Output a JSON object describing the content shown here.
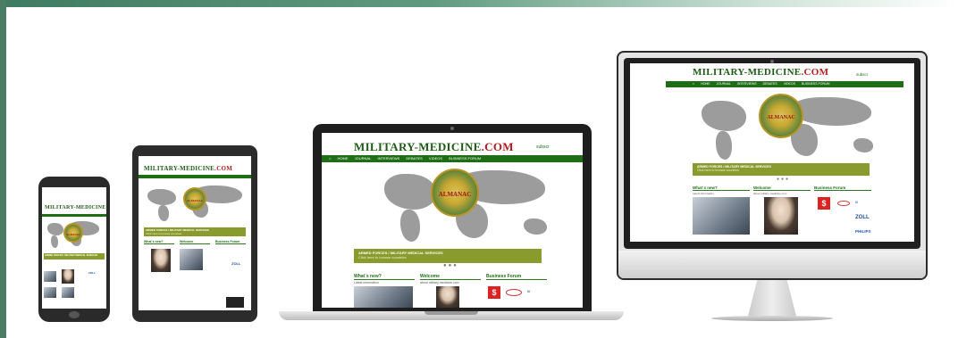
{
  "site": {
    "logo_small": "",
    "logo_main": "MILITARY-MEDICINE",
    "logo_tld": ".COM",
    "nav": [
      "HOME",
      "JOURNAL",
      "INTERVIEWS",
      "DEBATES",
      "VIDEOS",
      "BUSINESS FORUM"
    ],
    "emblem_text": "ALMANAC",
    "banner_title": "ARMED FORCES / MILITARY MEDICAL SERVICES",
    "banner_subtitle": "Click here to browse countries",
    "section_whats_new": "What´s new?",
    "whats_new_sub": "Latest information",
    "section_welcome": "Welcome",
    "welcome_sub": "about military-medicine.com",
    "section_business": "Business Forum",
    "sponsors": [
      "ZOLL",
      "PHILIPS"
    ],
    "lang_switch": "subscr"
  },
  "colors": {
    "nav_green": "#1e6e16",
    "banner_olive": "#8a9b2e",
    "logo_red": "#b21e1e",
    "frame_green": "#4b7d66"
  }
}
